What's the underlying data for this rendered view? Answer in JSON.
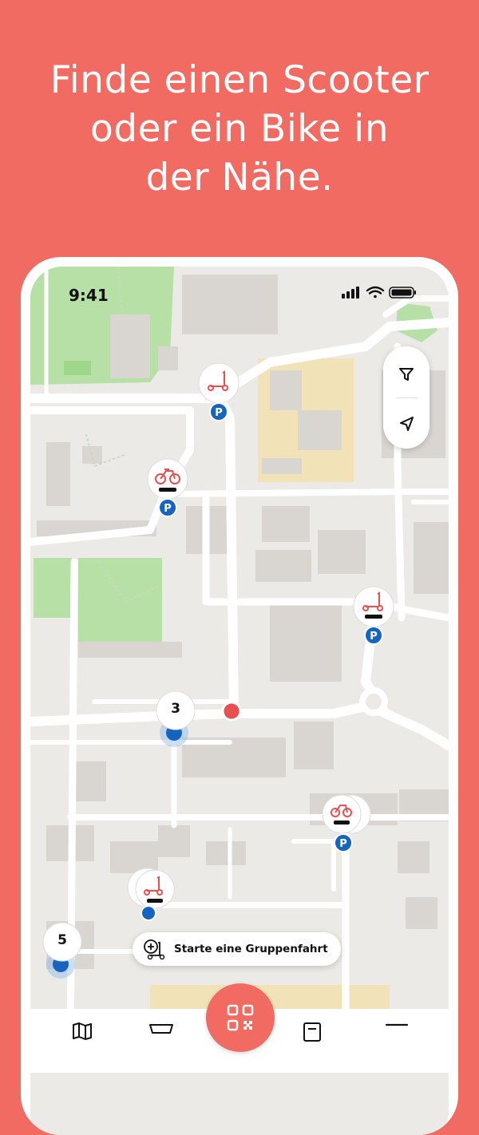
{
  "headline": {
    "line1": "Finde einen Scooter",
    "line2": "oder ein Bike in",
    "line3": "der Nähe."
  },
  "status_bar": {
    "time": "9:41"
  },
  "map": {
    "clusters": [
      {
        "count": "3"
      },
      {
        "count": "5"
      }
    ],
    "user_location_color": "#E94F4F",
    "parking_badge_label": "P",
    "parking_badge_color": "#1565C0"
  },
  "map_controls": {
    "filter_icon": "filter-funnel-icon",
    "locate_icon": "navigation-arrow-icon"
  },
  "group_ride": {
    "label": "Starte eine Gruppenfahrt",
    "icon": "group-ride-scooter-plus-icon"
  },
  "tab_bar": {
    "center_icon": "qr-code-icon",
    "accent": "#F26B62"
  },
  "colors": {
    "background": "#F26B62",
    "parks": "#B7E0A6",
    "blocks": "#D9D6D2",
    "buildings_yellow": "#F2E2B8"
  }
}
